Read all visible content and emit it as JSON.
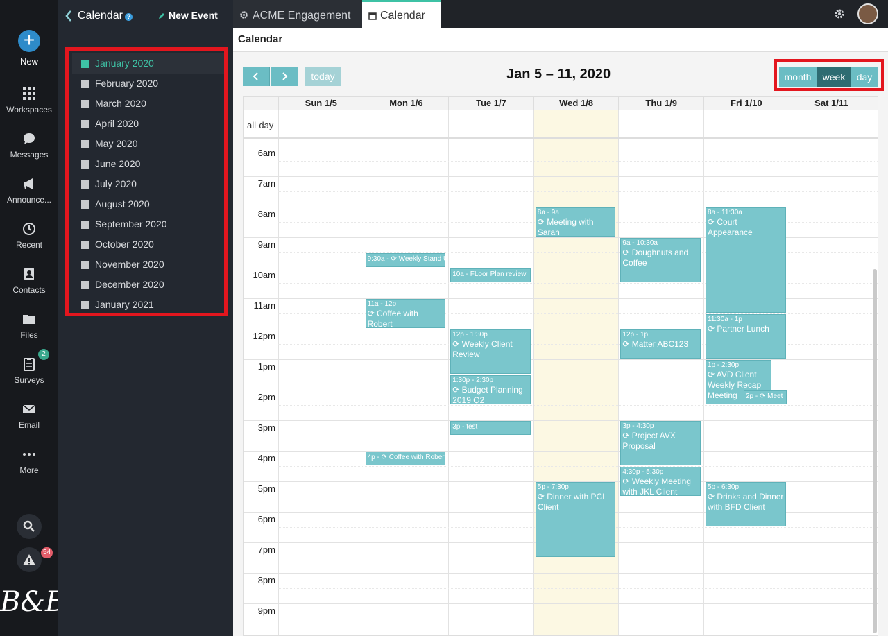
{
  "rail": {
    "new_label": "New",
    "items": [
      {
        "label": "Workspaces",
        "icon": "grid-icon"
      },
      {
        "label": "Messages",
        "icon": "chat-icon"
      },
      {
        "label": "Announce...",
        "icon": "megaphone-icon"
      },
      {
        "label": "Recent",
        "icon": "history-icon"
      },
      {
        "label": "Contacts",
        "icon": "contacts-icon"
      },
      {
        "label": "Files",
        "icon": "folder-icon"
      },
      {
        "label": "Surveys",
        "icon": "clipboard-icon",
        "badge": "2"
      },
      {
        "label": "Email",
        "icon": "envelope-icon"
      },
      {
        "label": "More",
        "icon": "more-icon"
      }
    ],
    "alerts_badge": "54",
    "logo_text": "B&B"
  },
  "sidebar": {
    "title": "Calendar",
    "new_event_label": "New Event",
    "months": [
      "January 2020",
      "February 2020",
      "March 2020",
      "April 2020",
      "May 2020",
      "June 2020",
      "July 2020",
      "August 2020",
      "September 2020",
      "October 2020",
      "November 2020",
      "December 2020",
      "January 2021"
    ],
    "active_month_index": 0
  },
  "tabs": [
    {
      "label": "ACME Engagement",
      "icon": "gear-icon"
    },
    {
      "label": "Calendar",
      "icon": "calendar-icon",
      "active": true
    }
  ],
  "main": {
    "breadcrumb": "Calendar",
    "today_label": "today",
    "range_title": "Jan 5 – 11, 2020",
    "views": [
      "month",
      "week",
      "day"
    ],
    "active_view": "week",
    "allday_label": "all-day",
    "days": [
      "Sun 1/5",
      "Mon 1/6",
      "Tue 1/7",
      "Wed 1/8",
      "Thu 1/9",
      "Fri 1/10",
      "Sat 1/11"
    ],
    "today_index": 3,
    "hours": [
      "6am",
      "7am",
      "8am",
      "9am",
      "10am",
      "11am",
      "12pm",
      "1pm",
      "2pm",
      "3pm",
      "4pm",
      "5pm",
      "6pm",
      "7pm",
      "8pm",
      "9pm"
    ],
    "events": [
      {
        "day": 1,
        "start": 9.5,
        "end": 10.0,
        "time": "9:30a -",
        "title": "Weekly Stand U",
        "single": true
      },
      {
        "day": 1,
        "start": 11.0,
        "end": 12.0,
        "time": "11a - 12p",
        "title": "Coffee with Robert"
      },
      {
        "day": 1,
        "start": 16.0,
        "end": 16.5,
        "time": "4p -",
        "title": "Coffee with Rober",
        "single": true
      },
      {
        "day": 2,
        "start": 10.0,
        "end": 10.5,
        "time": "10a - FLoor Plan review",
        "title": "",
        "single": true,
        "norecur": true
      },
      {
        "day": 2,
        "start": 12.0,
        "end": 13.5,
        "time": "12p - 1:30p",
        "title": "Weekly Client Review"
      },
      {
        "day": 2,
        "start": 13.5,
        "end": 14.5,
        "time": "1:30p - 2:30p",
        "title": "Budget Planning 2019 Q2"
      },
      {
        "day": 2,
        "start": 15.0,
        "end": 15.5,
        "time": "3p - test",
        "title": "",
        "single": true,
        "norecur": true
      },
      {
        "day": 3,
        "start": 8.0,
        "end": 9.0,
        "time": "8a - 9a",
        "title": "Meeting with Sarah"
      },
      {
        "day": 3,
        "start": 17.0,
        "end": 19.5,
        "time": "5p - 7:30p",
        "title": "Dinner with PCL Client"
      },
      {
        "day": 4,
        "start": 9.0,
        "end": 10.5,
        "time": "9a - 10:30a",
        "title": "Doughnuts and Coffee"
      },
      {
        "day": 4,
        "start": 12.0,
        "end": 13.0,
        "time": "12p - 1p",
        "title": "Matter ABC123"
      },
      {
        "day": 4,
        "start": 15.0,
        "end": 16.5,
        "time": "3p - 4:30p",
        "title": "Project AVX Proposal"
      },
      {
        "day": 4,
        "start": 16.5,
        "end": 17.5,
        "time": "4:30p - 5:30p",
        "title": "Weekly Meeting with JKL Client"
      },
      {
        "day": 5,
        "start": 8.0,
        "end": 11.5,
        "time": "8a - 11:30a",
        "title": "Court Appearance"
      },
      {
        "day": 5,
        "start": 11.5,
        "end": 13.0,
        "time": "11:30a - 1p",
        "title": "Partner Lunch"
      },
      {
        "day": 5,
        "start": 13.0,
        "end": 14.5,
        "time": "1p - 2:30p",
        "title": "AVD Client Weekly Recap Meeting",
        "narrow": true
      },
      {
        "day": 5,
        "start": 14.0,
        "end": 14.5,
        "time": "2p -",
        "title": "Meet",
        "single": true,
        "shifted": true
      },
      {
        "day": 5,
        "start": 17.0,
        "end": 18.5,
        "time": "5p - 6:30p",
        "title": "Drinks and Dinner with BFD Client"
      }
    ]
  },
  "colors": {
    "accent": "#6bbdc4",
    "event": "#7ac6cc",
    "highlight": "#e3161e",
    "active_month": "#3ec2a5"
  }
}
